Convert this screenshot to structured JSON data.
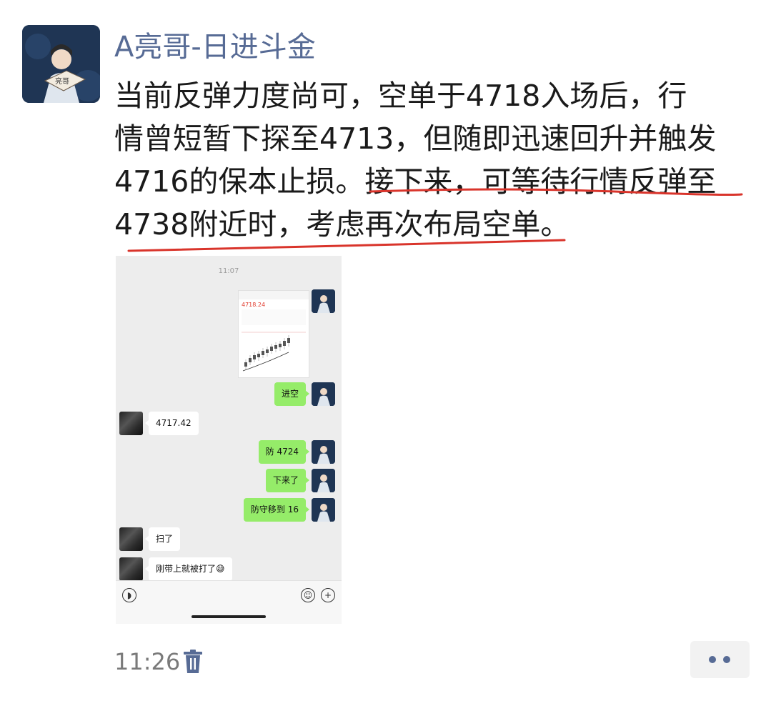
{
  "post": {
    "username": "A亮哥-日进斗金",
    "lines": [
      "当前反弹力度尚可，空单于4718入场后，行",
      "情曾短暂下探至4713，但随即迅速回升并触发",
      "4716的保本止损。",
      "接下来，可等待行情反弹至",
      "4738附近时，考虑再次布局空单。"
    ],
    "time": "11:26",
    "underline_color": "#d9342b"
  },
  "screenshot": {
    "time": "11:07",
    "thumb_price": "4718.24",
    "messages": [
      {
        "side": "me",
        "text": "进空"
      },
      {
        "side": "them",
        "text": "4717.42"
      },
      {
        "side": "me",
        "text": "防 4724"
      },
      {
        "side": "me",
        "text": "下来了"
      },
      {
        "side": "me",
        "text": "防守移到 16"
      },
      {
        "side": "them",
        "text": "扫了"
      },
      {
        "side": "them",
        "text": "刚带上就被打了😅"
      }
    ],
    "bubble_color": "#95ec69"
  },
  "colors": {
    "name": "#576b95",
    "text": "#1a1a1a"
  }
}
